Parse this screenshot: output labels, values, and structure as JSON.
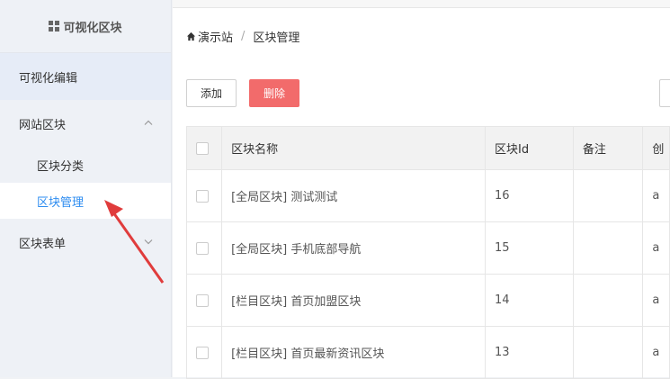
{
  "sidebar": {
    "title": "可视化区块",
    "items": [
      {
        "label": "可视化编辑"
      },
      {
        "label": "网站区块",
        "chevron": "chevron-up"
      },
      {
        "label": "区块分类"
      },
      {
        "label": "区块管理"
      },
      {
        "label": "区块表单",
        "chevron": "chevron-down"
      }
    ]
  },
  "breadcrumb": {
    "home": "演示站",
    "sep": "/",
    "current": "区块管理"
  },
  "toolbar": {
    "add_label": "添加",
    "delete_label": "删除"
  },
  "table": {
    "headers": [
      "区块名称",
      "区块Id",
      "备注",
      "创"
    ],
    "rows": [
      {
        "name": "[全局区块] 测试测试",
        "id": "16",
        "note": "",
        "extra": "a"
      },
      {
        "name": "[全局区块] 手机底部导航",
        "id": "15",
        "note": "",
        "extra": "a"
      },
      {
        "name": "[栏目区块] 首页加盟区块",
        "id": "14",
        "note": "",
        "extra": "a"
      },
      {
        "name": "[栏目区块] 首页最新资讯区块",
        "id": "13",
        "note": "",
        "extra": "a"
      }
    ]
  },
  "colors": {
    "accent": "#2d8cf0",
    "danger": "#f26b6b",
    "annotation": "#e03c3c"
  }
}
